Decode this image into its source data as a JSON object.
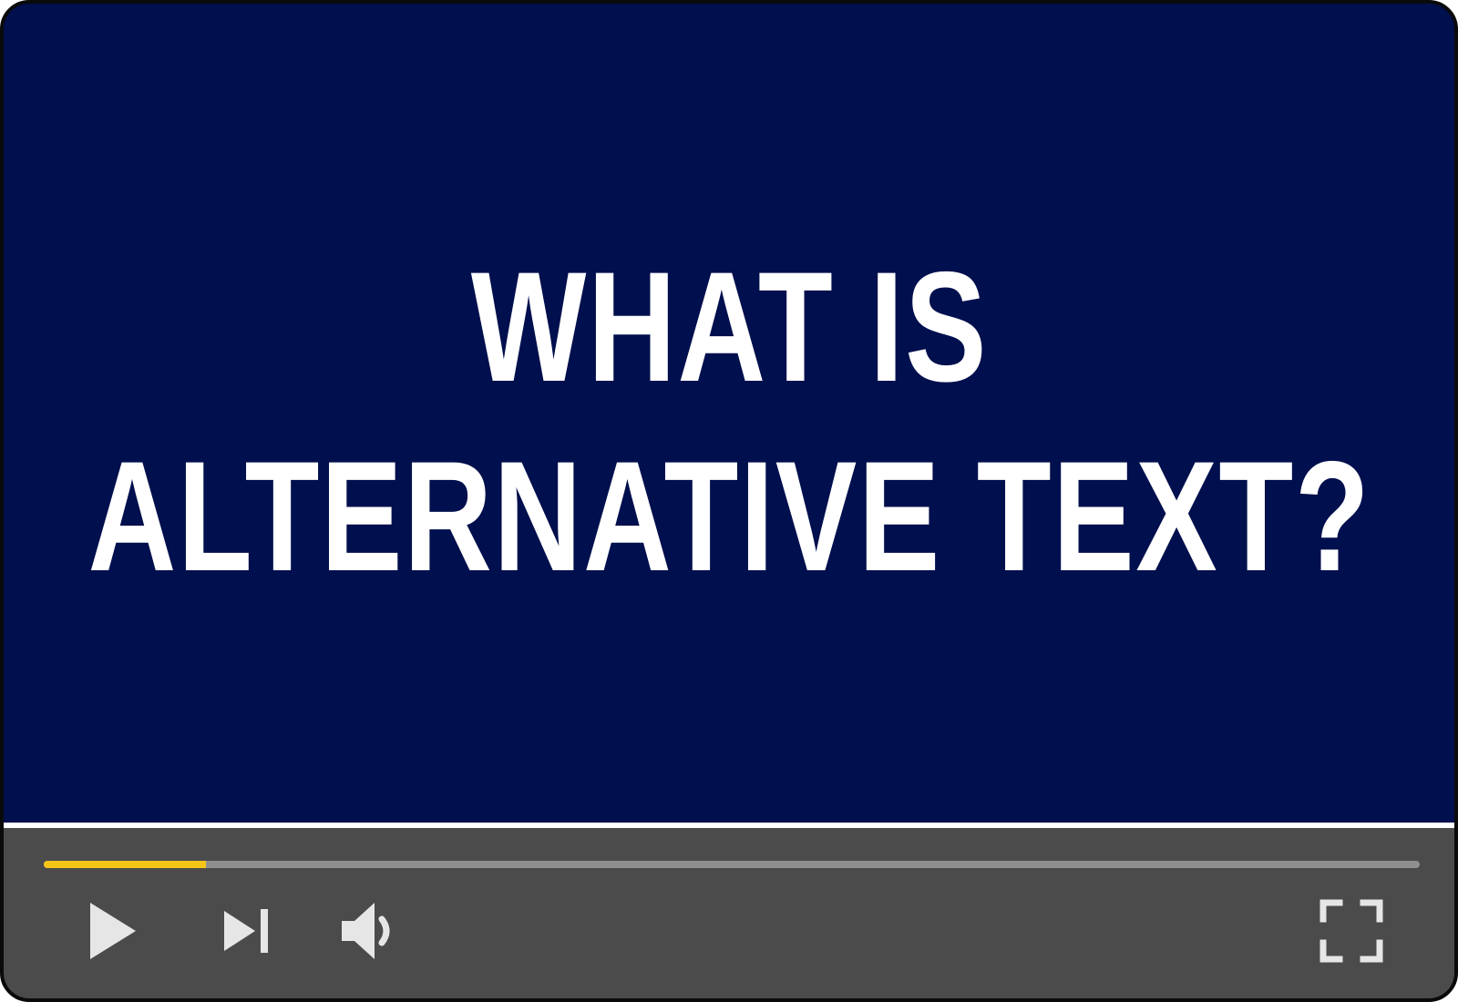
{
  "video": {
    "title_line1": "WHAT IS",
    "title_line2": "ALTERNATIVE TEXT?",
    "background_color": "#000f4d",
    "text_color": "#ffffff"
  },
  "controls": {
    "progress": {
      "played_fraction": 0.118,
      "played_color": "#f5c518",
      "track_color": "#8f8f8f"
    },
    "buttons": [
      {
        "name": "play",
        "icon": "play-icon"
      },
      {
        "name": "next",
        "icon": "skip-next-icon"
      },
      {
        "name": "volume",
        "icon": "volume-icon"
      },
      {
        "name": "fullscreen",
        "icon": "fullscreen-icon"
      }
    ],
    "bar_color": "#4b4b4b",
    "icon_color": "#e6e6e6"
  }
}
